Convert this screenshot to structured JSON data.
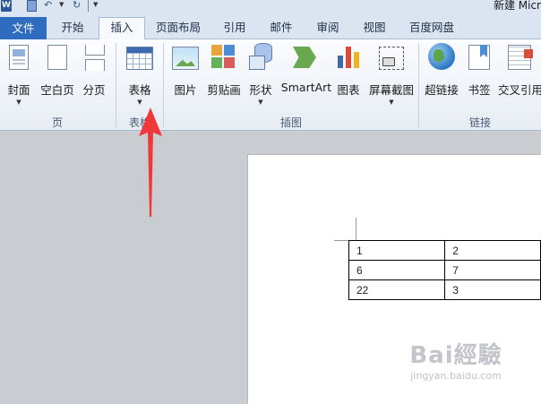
{
  "window": {
    "title": "新建 Micr",
    "app_icon_letter": "W"
  },
  "tabs": [
    "文件",
    "开始",
    "插入",
    "页面布局",
    "引用",
    "邮件",
    "审阅",
    "视图",
    "百度网盘"
  ],
  "active_tab": "插入",
  "ribbon": {
    "groups": [
      {
        "label": "页",
        "buttons": [
          {
            "label": "封面",
            "icon": "cover-page-icon",
            "dropdown": true
          },
          {
            "label": "空白页",
            "icon": "blank-page-icon",
            "dropdown": false
          },
          {
            "label": "分页",
            "icon": "page-break-icon",
            "dropdown": false
          }
        ]
      },
      {
        "label": "表格",
        "buttons": [
          {
            "label": "表格",
            "icon": "table-icon",
            "dropdown": true
          }
        ]
      },
      {
        "label": "插图",
        "buttons": [
          {
            "label": "图片",
            "icon": "picture-icon",
            "dropdown": false
          },
          {
            "label": "剪贴画",
            "icon": "clip-art-icon",
            "dropdown": false
          },
          {
            "label": "形状",
            "icon": "shapes-icon",
            "dropdown": true
          },
          {
            "label": "SmartArt",
            "icon": "smartart-icon",
            "dropdown": false
          },
          {
            "label": "图表",
            "icon": "chart-icon",
            "dropdown": false
          },
          {
            "label": "屏幕截图",
            "icon": "screenshot-icon",
            "dropdown": true
          }
        ]
      },
      {
        "label": "链接",
        "buttons": [
          {
            "label": "超链接",
            "icon": "hyperlink-globe-icon",
            "dropdown": false
          },
          {
            "label": "书签",
            "icon": "bookmark-icon",
            "dropdown": false
          },
          {
            "label": "交叉引用",
            "icon": "cross-reference-icon",
            "dropdown": false
          }
        ]
      }
    ],
    "dropdown_glyph": "▼"
  },
  "document": {
    "table": [
      [
        "1",
        "2"
      ],
      [
        "6",
        "7"
      ],
      [
        "22",
        "3"
      ]
    ]
  },
  "annotation": {
    "type": "arrow",
    "color": "#f0383a",
    "points_to": "表格"
  },
  "watermark": {
    "logo": "Bai經驗",
    "url": "jingyan.baidu.com"
  },
  "colors": {
    "file_tab": "#2f6bbf",
    "ribbon_bg": "#f0f4fa",
    "canvas_bg": "#c9ccd1"
  }
}
